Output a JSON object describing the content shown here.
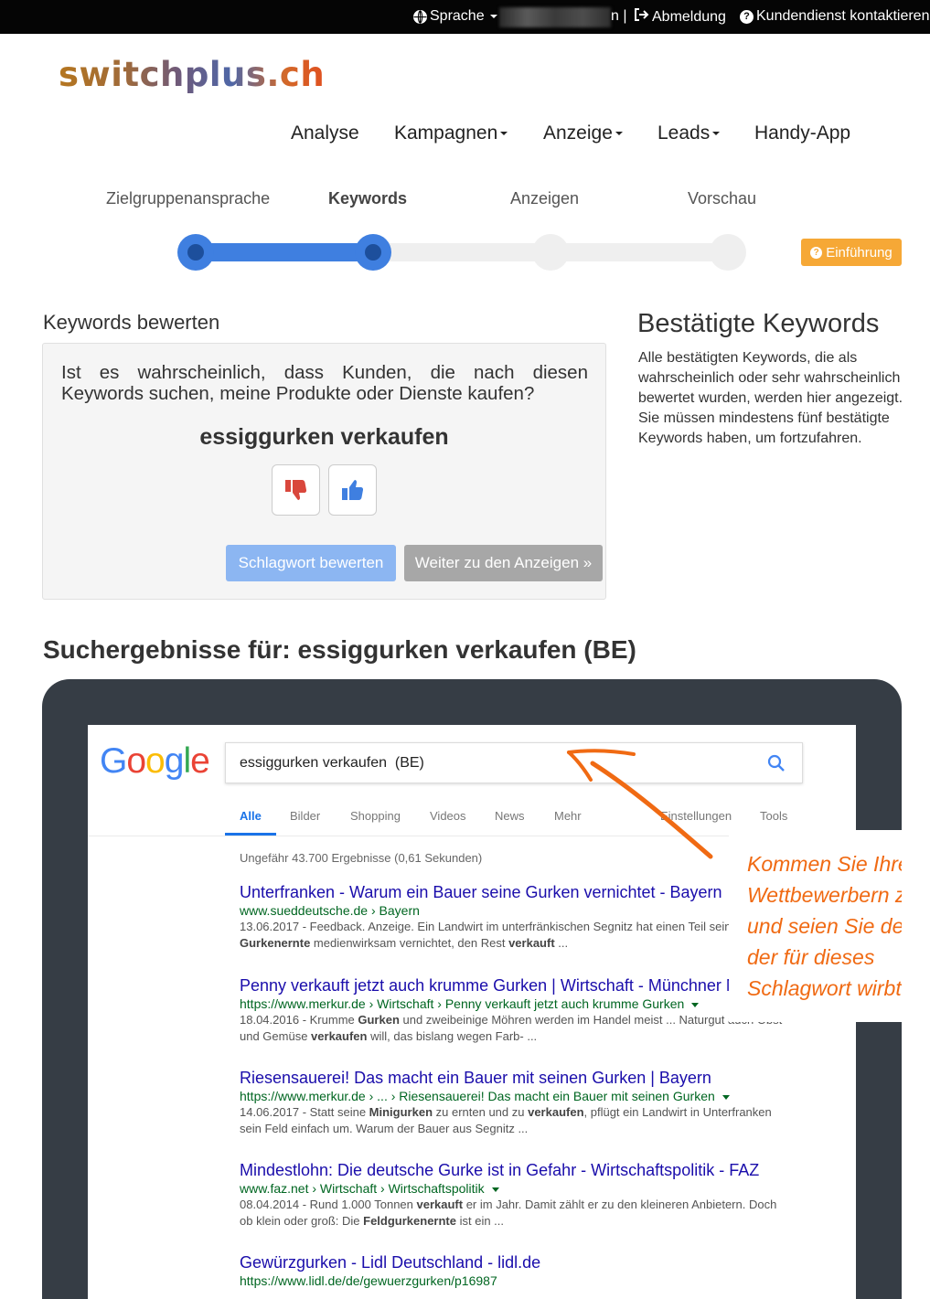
{
  "topbar": {
    "language_label": "Sprache",
    "account_suffix": "n |",
    "logout_label": "Abmeldung",
    "support_label": "Kundendienst kontaktieren"
  },
  "brand": {
    "logo_text": "switchplus.ch"
  },
  "mainnav": {
    "items": [
      {
        "label": "Analyse",
        "dropdown": false
      },
      {
        "label": "Kampagnen",
        "dropdown": true
      },
      {
        "label": "Anzeige",
        "dropdown": true
      },
      {
        "label": "Leads",
        "dropdown": true
      },
      {
        "label": "Handy-App",
        "dropdown": false
      }
    ]
  },
  "wizard": {
    "steps": [
      {
        "label": "Zielgruppenansprache",
        "state": "done"
      },
      {
        "label": "Keywords",
        "state": "current"
      },
      {
        "label": "Anzeigen",
        "state": "todo"
      },
      {
        "label": "Vorschau",
        "state": "todo"
      }
    ],
    "intro_button": "Einführung"
  },
  "rating": {
    "heading": "Keywords bewerten",
    "question_line1": "Ist es wahrscheinlich, dass Kunden, die nach diesen",
    "question_line2": "Keywords suchen, meine Produkte oder Dienste kaufen?",
    "keyword": "essiggurken verkaufen",
    "thumbs_down_icon": "thumbs-down-icon",
    "thumbs_up_icon": "thumbs-up-icon",
    "rate_button": "Schlagwort bewerten",
    "next_button": "Weiter zu den Anzeigen »"
  },
  "confirmed": {
    "heading": "Bestätigte Keywords",
    "text": "Alle bestätigten Keywords, die als wahrscheinlich oder sehr wahrscheinlich bewertet wurden, werden hier angezeigt. Sie müssen mindestens fünf bestätigte Keywords haben, um fortzufahren."
  },
  "results_heading": "Suchergebnisse für: essiggurken verkaufen (BE)",
  "google": {
    "query": "essiggurken verkaufen  (BE)",
    "tabs": [
      "Alle",
      "Bilder",
      "Shopping",
      "Videos",
      "News",
      "Mehr"
    ],
    "right_tabs": [
      "Einstellungen",
      "Tools"
    ],
    "result_count": "Ungefähr 43.700 Ergebnisse (0,61 Sekunden)",
    "results": [
      {
        "title": "Unterfranken - Warum ein Bauer seine Gurken vernichtet - Bayern",
        "url": "www.sueddeutsche.de › Bayern",
        "date": "13.06.2017",
        "snippet_a": " - Feedback. Anzeige. Ein Landwirt im unterfränkischen Segnitz hat einen Teil seiner",
        "bold_1": "Gurkenernte",
        "snippet_b": " medienwirksam vernichtet, den Rest ",
        "bold_2": "verkauft",
        "snippet_c": " ..."
      },
      {
        "title": "Penny verkauft jetzt auch krumme Gurken | Wirtschaft - Münchner Merkur",
        "url": "https://www.merkur.de › Wirtschaft › Penny verkauft jetzt auch krumme Gurken",
        "date": "18.04.2016",
        "snippet_a": " - Krumme ",
        "bold_1": "Gurken",
        "snippet_b": " und zweibeinige Möhren werden im Handel meist ... Naturgut auch Obst",
        "snippet_c": "und Gemüse ",
        "bold_2": "verkaufen",
        "snippet_d": " will, das bislang wegen Farb- ..."
      },
      {
        "title": "Riesensauerei! Das macht ein Bauer mit seinen Gurken | Bayern",
        "url": "https://www.merkur.de › ... › Riesensauerei! Das macht ein Bauer mit seinen Gurken",
        "date": "14.06.2017",
        "snippet_a": " - Statt seine ",
        "bold_1": "Minigurken",
        "snippet_b": " zu ernten und zu ",
        "bold_2": "verkaufen",
        "snippet_c": ", pflügt ein Landwirt in Unterfranken",
        "snippet_d": "sein Feld einfach um. Warum der Bauer aus Segnitz ..."
      },
      {
        "title": "Mindestlohn: Die deutsche Gurke ist in Gefahr - Wirtschaftspolitik - FAZ",
        "url": "www.faz.net › Wirtschaft › Wirtschaftspolitik",
        "date": "08.04.2014",
        "snippet_a": " - Rund 1.000 Tonnen ",
        "bold_1": "verkauft",
        "snippet_b": " er im Jahr. Damit zählt er zu den kleineren Anbietern. Doch",
        "snippet_c": "ob klein oder groß: Die ",
        "bold_2": "Feldgurkenernte",
        "snippet_d": " ist ein ..."
      },
      {
        "title": "Gewürzgurken - Lidl Deutschland - lidl.de",
        "url": "https://www.lidl.de/de/gewuerzgurken/p16987"
      }
    ]
  },
  "callout": {
    "lines": [
      "Kommen Sie Ihren",
      "Wettbewerbern zuvor",
      "und seien Sie der Erste,",
      "der für dieses",
      "Schlagwort wirbt"
    ]
  },
  "colors": {
    "accent": "#3f7fe0",
    "intro_orange": "#f6a836",
    "callout_orange": "#f06a13",
    "frame": "#363d45",
    "google_link": "#1a0dab",
    "google_url": "#006621"
  }
}
